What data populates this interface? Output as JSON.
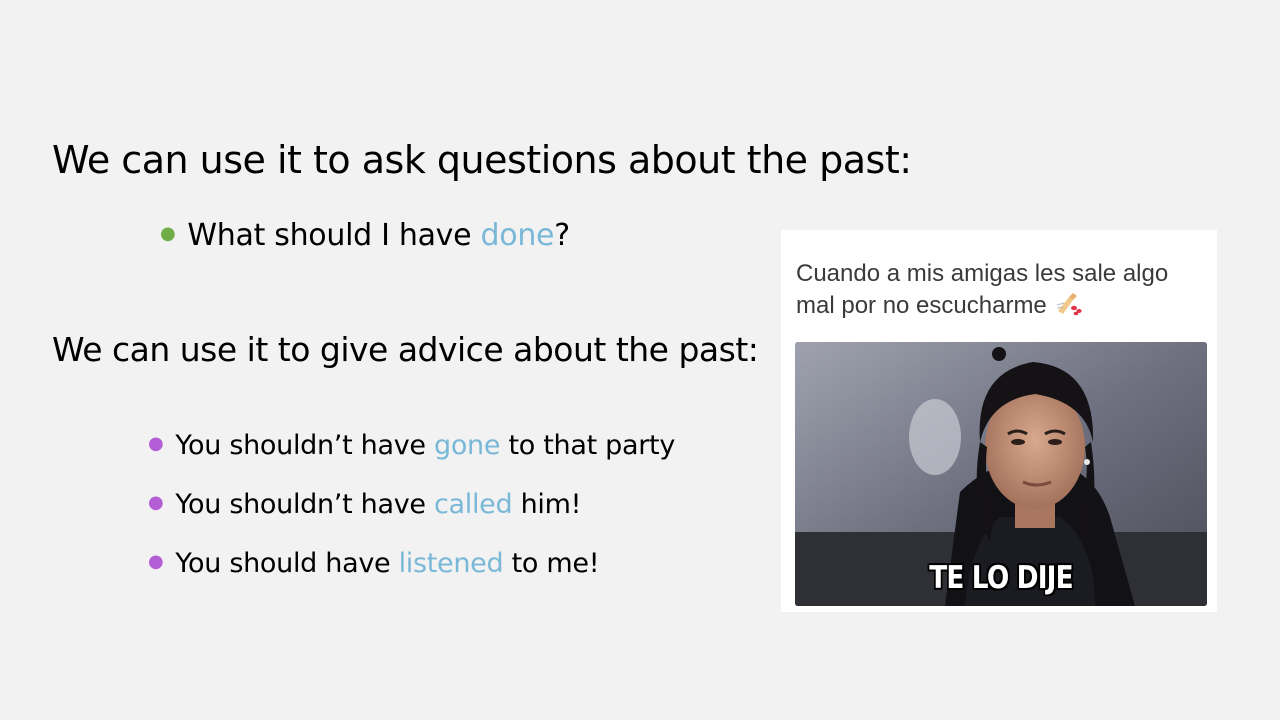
{
  "slide": {
    "heading_1": "We can use it to ask questions about the past:",
    "question": {
      "before": "What should I have ",
      "highlight": "done",
      "after": "?"
    },
    "heading_2": "We can use it to give advice about the past:",
    "advice": [
      {
        "before": "You shouldn’t have ",
        "highlight": "gone",
        "after": " to that party"
      },
      {
        "before": "You shouldn’t have ",
        "highlight": "called",
        "after": " him!"
      },
      {
        "before": "You should have ",
        "highlight": "listened",
        "after": " to me!"
      }
    ]
  },
  "meme": {
    "caption": "Cuando a mis amigas les sale algo mal por no escucharme",
    "emoji": "nail-polish-icon",
    "overlay_text": "TE LO DIJE"
  },
  "colors": {
    "background": "#f2f2f2",
    "highlight": "#7ab8d8",
    "bullet_green": "#70ad47",
    "bullet_purple": "#b45ed6"
  }
}
